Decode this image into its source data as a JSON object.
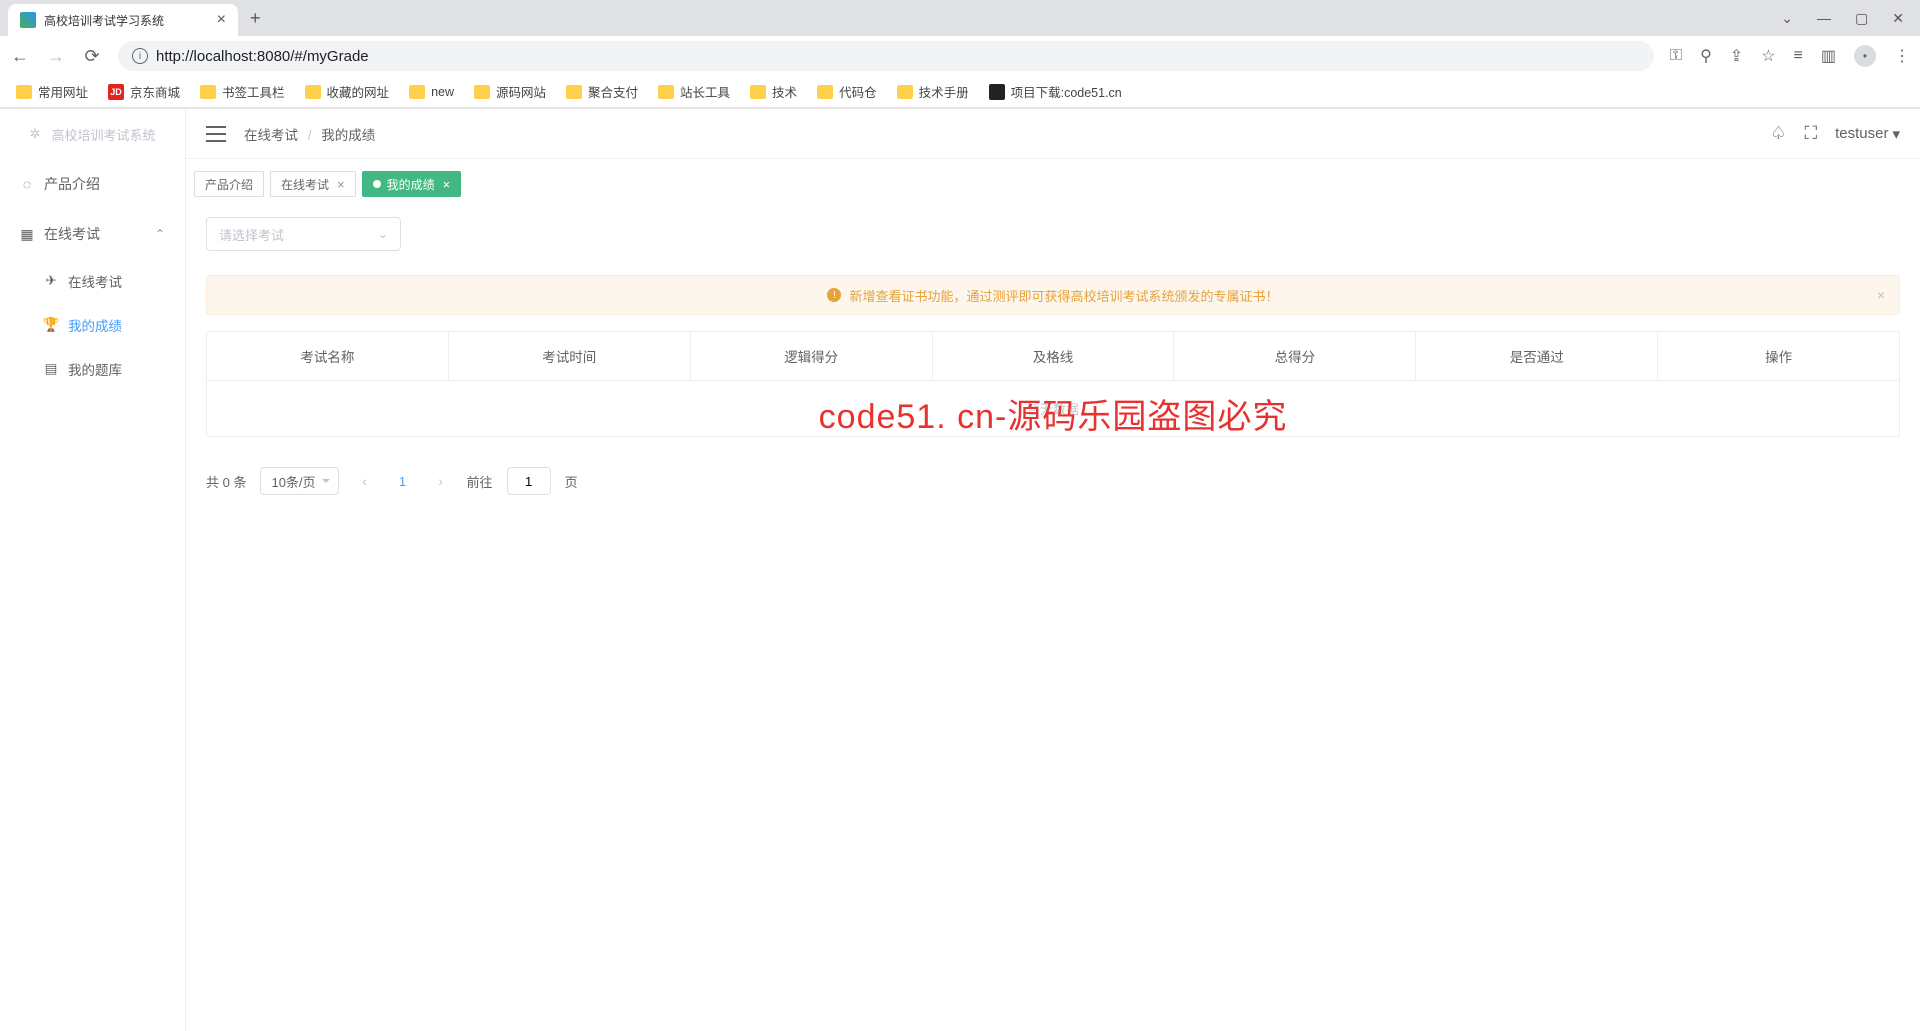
{
  "browser": {
    "tab_title": "高校培训考试学习系统",
    "url_display": "http://localhost:8080/#/myGrade",
    "bookmarks": [
      "常用网址",
      "京东商城",
      "书签工具栏",
      "收藏的网址",
      "new",
      "源码网站",
      "聚合支付",
      "站长工具",
      "技术",
      "代码仓",
      "技术手册",
      "项目下载:code51.cn"
    ]
  },
  "sidebar": {
    "brand": "高校培训考试系统",
    "items": [
      {
        "label": "产品介绍"
      },
      {
        "label": "在线考试",
        "expanded": true,
        "children": [
          {
            "label": "在线考试"
          },
          {
            "label": "我的成绩",
            "active": true
          },
          {
            "label": "我的题库"
          }
        ]
      }
    ]
  },
  "topbar": {
    "breadcrumb": [
      "在线考试",
      "我的成绩"
    ],
    "user": "testuser"
  },
  "page_tabs": [
    {
      "label": "产品介绍",
      "active": false,
      "closable": false
    },
    {
      "label": "在线考试",
      "active": false,
      "closable": true
    },
    {
      "label": "我的成绩",
      "active": true,
      "closable": true
    }
  ],
  "filter": {
    "placeholder": "请选择考试"
  },
  "alert": {
    "text": "新增查看证书功能，通过测评即可获得高校培训考试系统颁发的专属证书！"
  },
  "table": {
    "headers": [
      "考试名称",
      "考试时间",
      "逻辑得分",
      "及格线",
      "总得分",
      "是否通过",
      "操作"
    ],
    "empty_text": "暂无数据"
  },
  "pagination": {
    "total_text": "共 0 条",
    "page_size": "10条/页",
    "current": "1",
    "jump_prefix": "前往",
    "jump_value": "1",
    "jump_suffix": "页"
  },
  "watermark": "code51. cn-源码乐园盗图必究"
}
